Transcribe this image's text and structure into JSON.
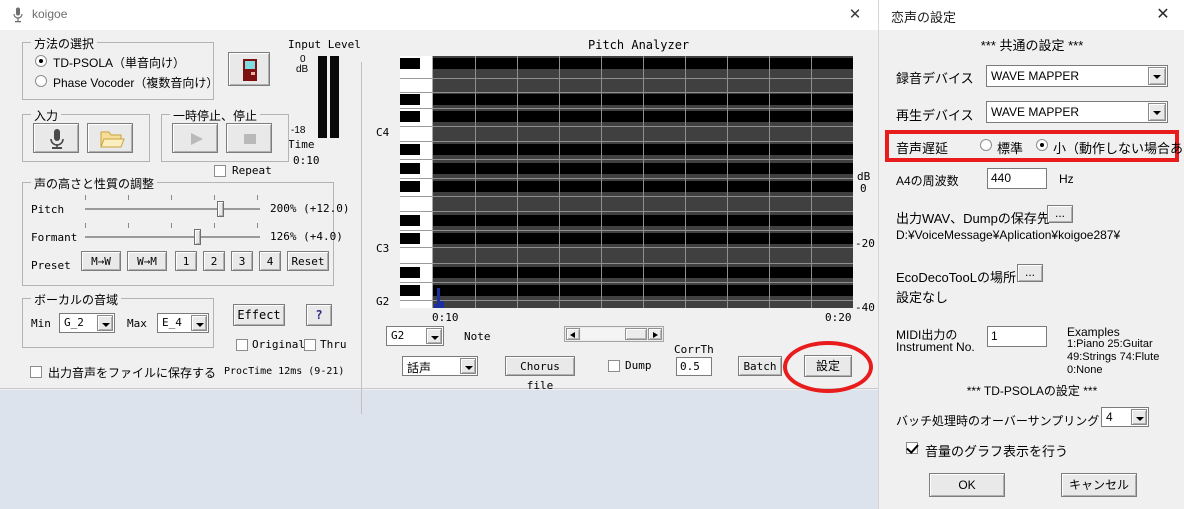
{
  "main_window": {
    "title": "koigoe",
    "title_icon": "microphone-icon",
    "close_label": "✕",
    "method_group": {
      "title": "方法の選択",
      "options": [
        {
          "label": "TD-PSOLA（単音向け）",
          "selected": true
        },
        {
          "label": "Phase Vocoder（複数音向け）",
          "selected": false
        }
      ]
    },
    "record_button_icon": "record-device-icon",
    "input_level": {
      "title": "Input Level",
      "top_label_0": "0",
      "top_label_db": "dB",
      "bottom_label": "-18"
    },
    "time": {
      "label": "Time",
      "value": "0:10"
    },
    "input_group": {
      "title": "入力",
      "mic_button_icon": "microphone-icon",
      "open_file_button_icon": "folder-icon"
    },
    "transport_group": {
      "title": "一時停止、停止",
      "play_button_icon": "play-icon",
      "stop_button_icon": "stop-icon"
    },
    "repeat": {
      "label": "Repeat",
      "checked": false
    },
    "adjust_group": {
      "title": "声の高さと性質の調整",
      "pitch": {
        "label": "Pitch",
        "value_text": "200% (+12.0)",
        "thumb_pct": 76
      },
      "formant": {
        "label": "Formant",
        "value_text": "126% (+4.0)",
        "thumb_pct": 67
      },
      "preset": {
        "label": "Preset",
        "buttons": [
          "M→W",
          "W→M",
          "1",
          "2",
          "3",
          "4",
          "Reset"
        ]
      }
    },
    "vocal_range_group": {
      "title": "ボーカルの音域",
      "min_label": "Min",
      "min_value": "G_2",
      "max_label": "Max",
      "max_value": "E_4"
    },
    "effect_button": "Effect",
    "help_button": "?",
    "original": {
      "label": "Original",
      "checked": false
    },
    "thru": {
      "label": "Thru",
      "checked": false
    },
    "save_output": {
      "label": "出力音声をファイルに保存する",
      "checked": false
    },
    "proc_time": "ProcTime 12ms (9-21)"
  },
  "pitch_analyzer": {
    "title": "Pitch Analyzer",
    "note_labels": [
      "C4",
      "C3",
      "G2"
    ],
    "db_axis": {
      "unit": "dB",
      "top": "0",
      "mid": "-20",
      "bottom": "-40"
    },
    "time_axis": {
      "start": "0:10",
      "end": "0:20"
    },
    "note_select_value": "G2",
    "note_label": "Note",
    "voice_type_value": "話声",
    "chorus_file_button": "Chorus file",
    "dump": {
      "label": "Dump",
      "checked": false
    },
    "corr_th": {
      "label": "CorrTh",
      "value": "0.5"
    },
    "batch_button": "Batch",
    "settings_button": "設定",
    "settings_button_highlighted": true,
    "blob_color": "#1b2f9e"
  },
  "settings_window": {
    "title": "恋声の設定",
    "close_label": "✕",
    "common_header": "*** 共通の設定 ***",
    "rec_device": {
      "label": "録音デバイス",
      "value": "WAVE MAPPER"
    },
    "play_device": {
      "label": "再生デバイス",
      "value": "WAVE MAPPER"
    },
    "audio_delay": {
      "label": "音声遅延",
      "options": [
        {
          "label": "標準",
          "selected": false
        },
        {
          "label": "小（動作しない場合あり）",
          "selected": true
        }
      ],
      "highlighted": true,
      "highlight_color": "#e81c1c"
    },
    "a4_freq": {
      "label": "A4の周波数",
      "value": "440",
      "unit": "Hz"
    },
    "wav_dump": {
      "label": "出力WAV、Dumpの保存先",
      "browse_button": "...",
      "path": "D:¥VoiceMessage¥Aplication¥koigoe287¥"
    },
    "ecodeco": {
      "label": "EcoDecoTooLの場所",
      "browse_button": "...",
      "value": "設定なし"
    },
    "midi": {
      "label_line1": "MIDI出力の",
      "label_line2": "Instrument No.",
      "value": "1",
      "examples_title": "Examples",
      "examples": [
        "1:Piano  25:Guitar",
        "49:Strings  74:Flute",
        "0:None"
      ]
    },
    "tdpsola_header": "*** TD-PSOLAの設定 ***",
    "oversampling": {
      "label": "バッチ処理時のオーバーサンプリング",
      "value": "4"
    },
    "volume_graph": {
      "label": "音量のグラフ表示を行う",
      "checked": true
    },
    "ok_button": "OK",
    "cancel_button": "キャンセル"
  }
}
